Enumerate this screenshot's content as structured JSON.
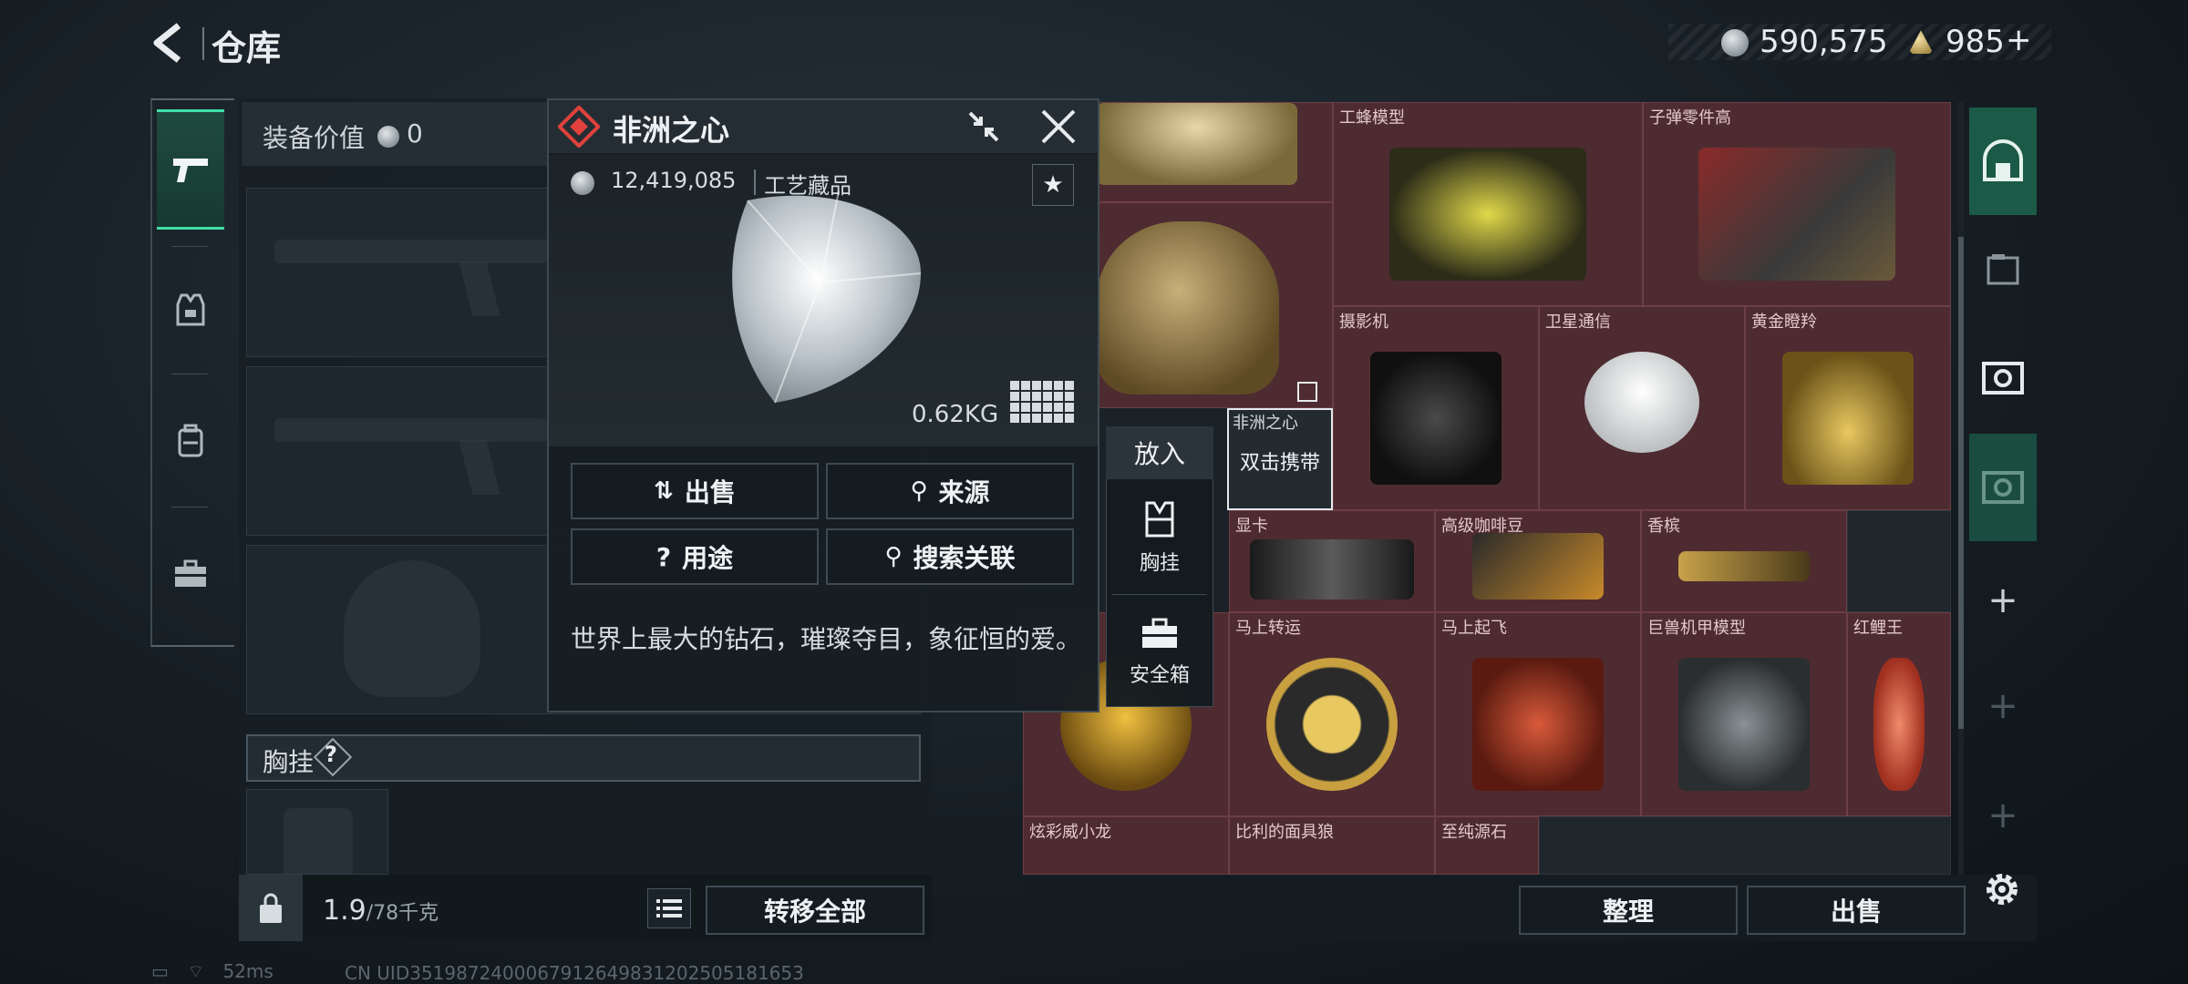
{
  "header": {
    "title": "仓库",
    "silver_amount": "590,575",
    "gold_amount": "985",
    "gold_plus": "+"
  },
  "equip": {
    "value_label": "装备价值",
    "value": "0",
    "chest_label": "胸挂",
    "chest_help": "?",
    "weight_current": "1.9",
    "weight_max": "/78千克",
    "transfer_all": "转移全部"
  },
  "popup": {
    "title": "非洲之心",
    "price": "12,419,085",
    "category": "工艺藏品",
    "weight": "0.62KG",
    "buttons": {
      "sell": "出售",
      "source": "来源",
      "use": "用途",
      "search_related": "搜索关联"
    },
    "description": "世界上最大的钻石，璀璨夺目，象征恒的爱。"
  },
  "place_menu": {
    "title": "放入",
    "chest": "胸挂",
    "safe_box": "安全箱"
  },
  "preview_cell": {
    "label": "非洲之心",
    "caption": "双击携带"
  },
  "grid_items": {
    "bee_model": "工蜂模型",
    "bullet_parts": "子弹零件高",
    "camera": "摄影机",
    "satellite": "卫星通信",
    "gold_deer": "黄金瞪羚",
    "gpu": "显卡",
    "coffee": "高级咖啡豆",
    "champagne": "香槟",
    "horse_coin": "马上转运",
    "horse_fly": "马上起飞",
    "mecha": "巨兽机甲模型",
    "red_fish": "红鲤王",
    "dragon": "炫彩威小龙",
    "wolf_mask": "比利的面具狼",
    "pure_stone": "至纯源石"
  },
  "bottom": {
    "organize": "整理",
    "sell": "出售"
  },
  "status": {
    "ping": "52ms",
    "uid": "CN UID3519872400067912649831202505181653"
  }
}
